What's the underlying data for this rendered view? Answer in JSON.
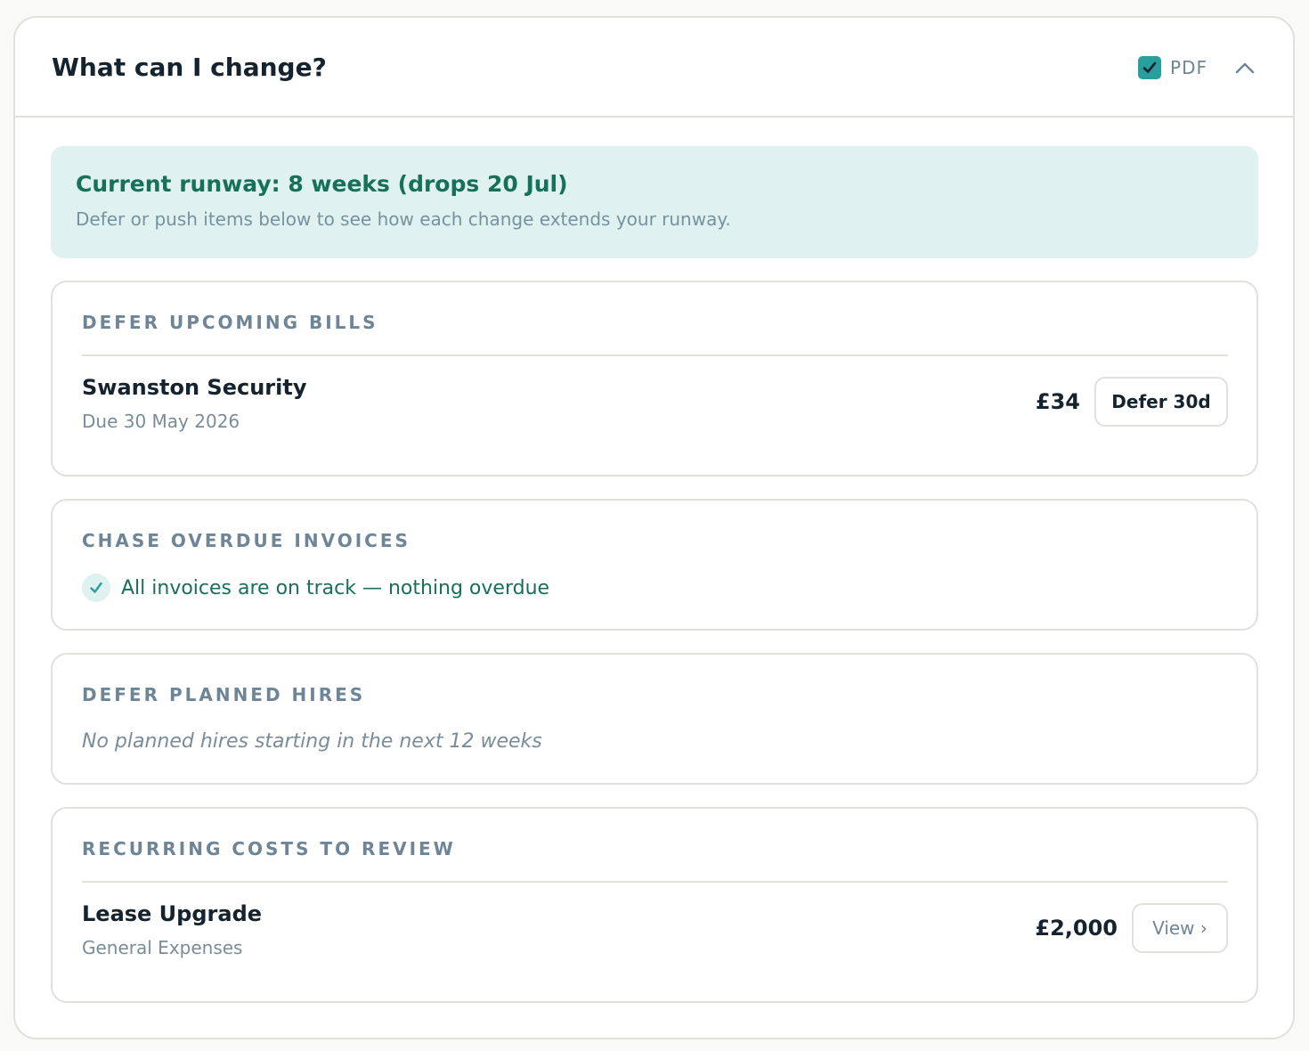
{
  "header": {
    "title": "What can I change?",
    "pdf_label": "PDF",
    "pdf_checked": true
  },
  "runway": {
    "title": "Current runway: 8 weeks (drops 20 Jul)",
    "subtitle": "Defer or push items below to see how each change extends your runway."
  },
  "sections": {
    "bills": {
      "heading": "DEFER UPCOMING BILLS",
      "items": [
        {
          "name": "Swanston Security",
          "detail": "Due 30 May 2026",
          "amount": "£34",
          "action": "Defer 30d"
        }
      ]
    },
    "invoices": {
      "heading": "CHASE OVERDUE INVOICES",
      "status": "All invoices are on track — nothing overdue"
    },
    "hires": {
      "heading": "DEFER PLANNED HIRES",
      "empty_note": "No planned hires starting in the next 12 weeks"
    },
    "recurring": {
      "heading": "RECURRING COSTS TO REVIEW",
      "items": [
        {
          "name": "Lease Upgrade",
          "detail": "General Expenses",
          "amount": "£2,000",
          "action": "View ›"
        }
      ]
    }
  },
  "colors": {
    "accent": "#2a9d9d",
    "success": "#17705a",
    "banner_bg": "#dff2f0"
  }
}
